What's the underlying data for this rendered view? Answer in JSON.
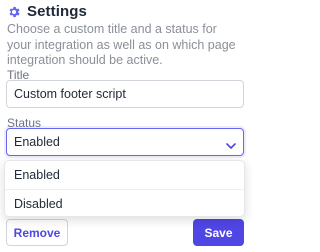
{
  "header": {
    "title": "Settings",
    "icon": "gear-icon",
    "description": "Choose a custom title and a status for your integration as well as on which page integration should be active."
  },
  "form": {
    "title_label": "Title",
    "title_value": "Custom footer script",
    "status_label": "Status",
    "status_value": "Enabled",
    "status_options": [
      "Enabled",
      "Disabled"
    ]
  },
  "actions": {
    "remove_label": "Remove",
    "save_label": "Save"
  },
  "colors": {
    "accent": "#4f46e5",
    "focus_border": "#6366f1",
    "muted_text": "#8a8f98"
  }
}
